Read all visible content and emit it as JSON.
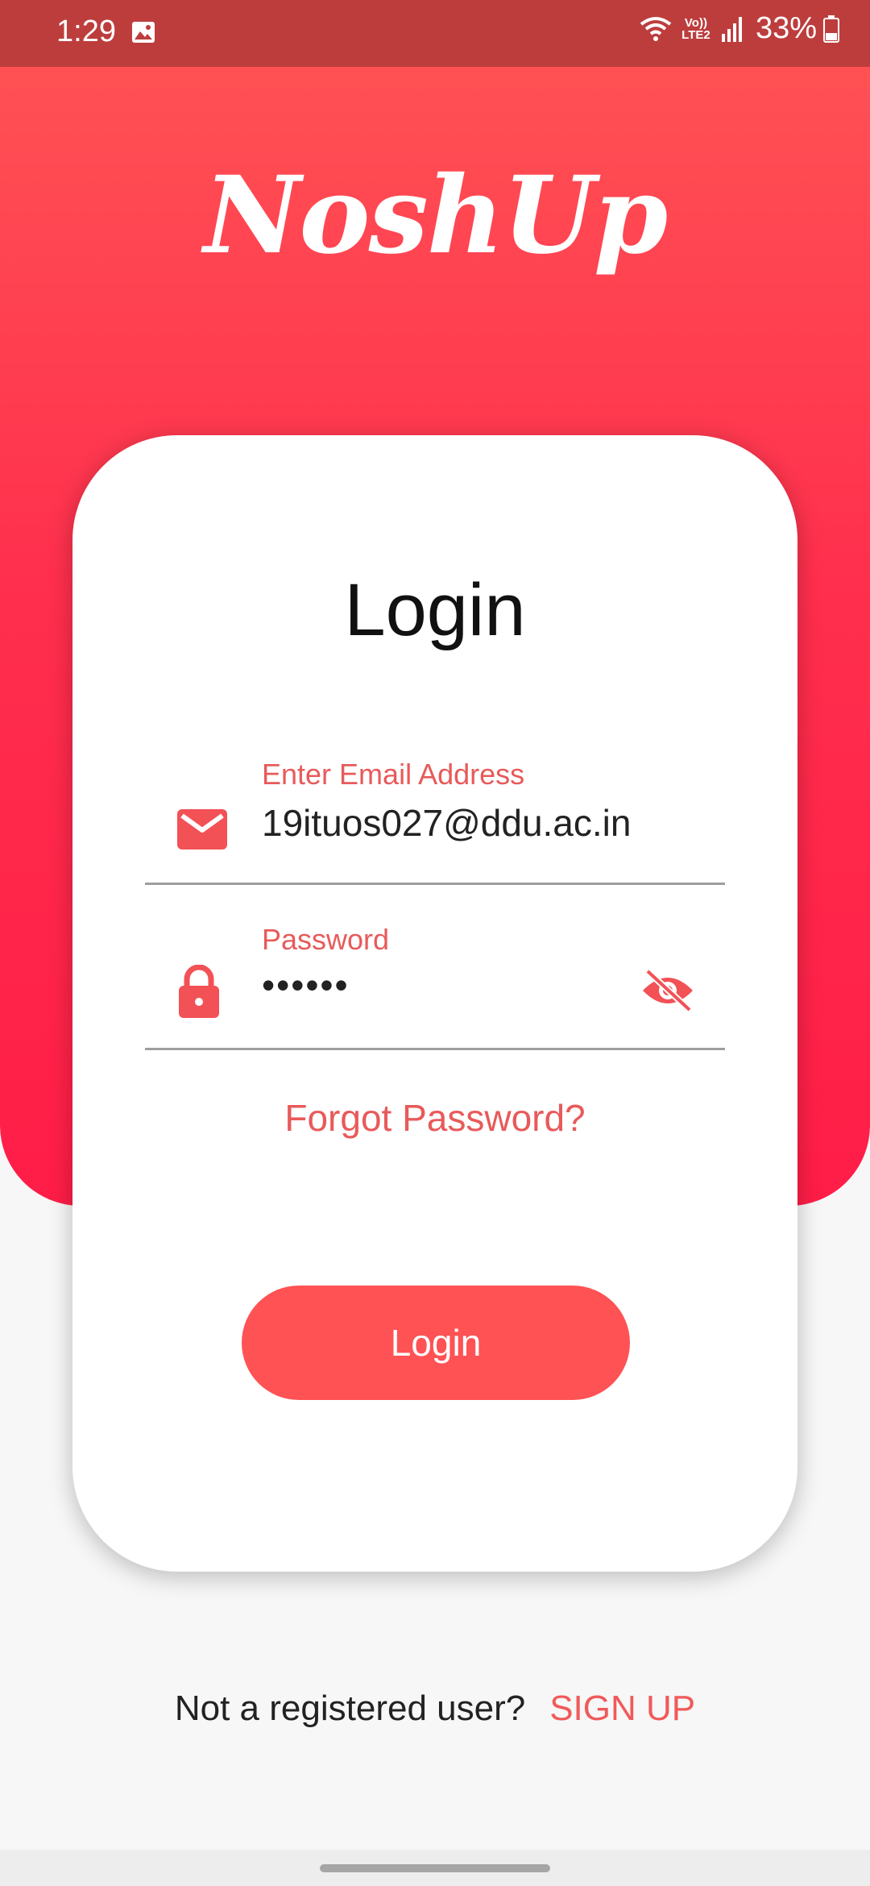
{
  "status_bar": {
    "time": "1:29",
    "network_label": "Vo)) LTE2",
    "battery": "33%"
  },
  "app": {
    "logo_text": "NoshUp"
  },
  "card": {
    "title": "Login",
    "email": {
      "label": "Enter Email Address",
      "value": "19ituos027@ddu.ac.in",
      "icon": "envelope-icon"
    },
    "password": {
      "label": "Password",
      "value": "••••••",
      "icon": "lock-icon",
      "toggle_icon": "eye-off-icon"
    },
    "forgot_label": "Forgot Password?",
    "login_button": "Login"
  },
  "footer": {
    "question": "Not a registered user?",
    "signup_label": "SIGN UP"
  },
  "colors": {
    "accent": "#ff5254",
    "gradient_top": "#ff5154",
    "gradient_bottom": "#ff1d47",
    "label": "#e85a5a",
    "status_bar": "#bd3d3d"
  }
}
